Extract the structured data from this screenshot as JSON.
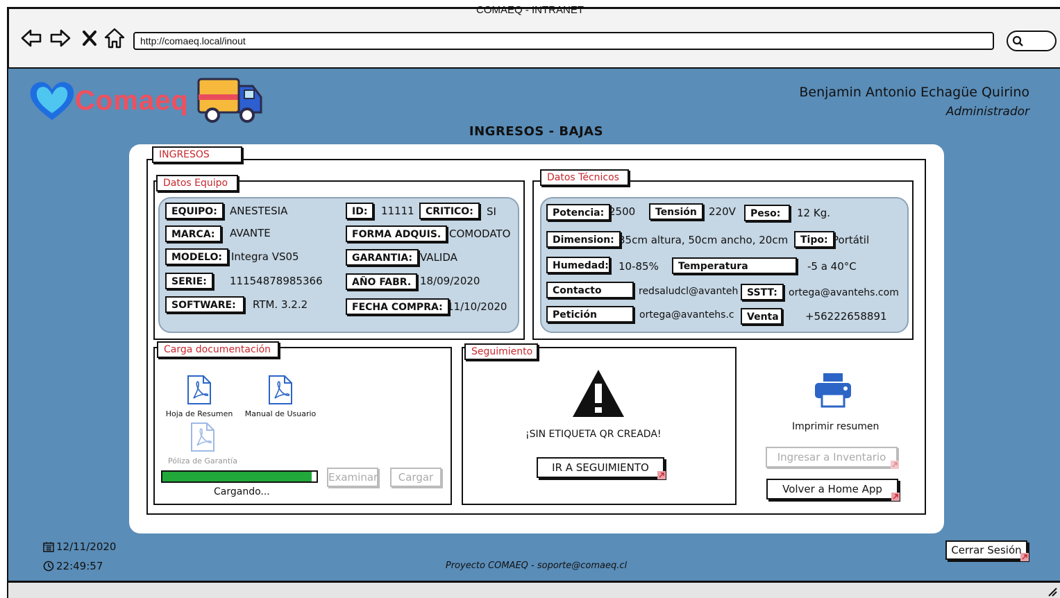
{
  "window": {
    "title": "COMAEQ - INTRANET",
    "url": "http://comaeq.local/inout"
  },
  "app": {
    "logo_text": "Comaeq",
    "user_name": "Benjamin Antonio Echagüe Quirino",
    "user_role": "Administrador",
    "page_title": "INGRESOS - BAJAS"
  },
  "ingresos": {
    "label": "INGRESOS",
    "datos_equipo": {
      "label": "Datos Equipo",
      "equipo_label": "EQUIPO:",
      "equipo": "ANESTESIA",
      "marca_label": "MARCA:",
      "marca": "AVANTE",
      "modelo_label": "MODELO:",
      "modelo": "Integra VS05",
      "serie_label": "SERIE:",
      "serie": "11154878985366",
      "software_label": "SOFTWARE:",
      "software": "RTM. 3.2.2",
      "id_label": "ID:",
      "id": "11111",
      "critico_label": "CRITICO:",
      "critico": "SI",
      "forma_label": "FORMA ADQUIS.",
      "forma": "COMODATO",
      "garantia_label": "GARANTIA:",
      "garantia": "VALIDA",
      "anio_label": "AÑO FABR.",
      "anio": "18/09/2020",
      "fecha_label": "FECHA COMPRA:",
      "fecha": "11/10/2020"
    },
    "datos_tecnicos": {
      "label": "Datos Técnicos",
      "potencia_label": "Potencia:",
      "potencia": "2500",
      "tension_label": "Tensión",
      "tension": "220V",
      "peso_label": "Peso:",
      "peso": "12 Kg.",
      "dimension_label": "Dimension:",
      "dimension": "35cm altura, 50cm ancho, 20cm",
      "tipo_label": "Tipo:",
      "tipo": "Portátil",
      "humedad_label": "Humedad:",
      "humedad": "10-85%",
      "temperatura_label": "Temperatura",
      "temperatura": "-5 a 40°C",
      "contacto_label": "Contacto",
      "contacto": "redsaludcl@avanteh",
      "sstt_label": "SSTT:",
      "sstt": "ortega@avantehs.com",
      "peticion_label": "Petición",
      "peticion": "ortega@avantehs.c",
      "venta_label": "Venta",
      "venta": "+56222658891"
    },
    "carga": {
      "label": "Carga documentación",
      "docs": [
        "Hoja de Resumen",
        "Manual de Usuario",
        "Póliza de Garantía"
      ],
      "progress": 0.97,
      "status": "Cargando...",
      "examinar": "Examinar",
      "cargar": "Cargar"
    },
    "seguimiento": {
      "label": "Seguimiento",
      "warning": "¡SIN ETIQUETA QR CREADA!",
      "button": "IR A SEGUIMIENTO"
    },
    "acciones": {
      "imprimir": "Imprimir resumen",
      "ingresar": "Ingresar a Inventario",
      "volver": "Volver a Home App"
    }
  },
  "footer": {
    "date": "12/11/2020",
    "time": "22:49:57",
    "project": "Proyecto COMAEQ - soporte@comaeq.cl",
    "logout": "Cerrar Sesión"
  }
}
